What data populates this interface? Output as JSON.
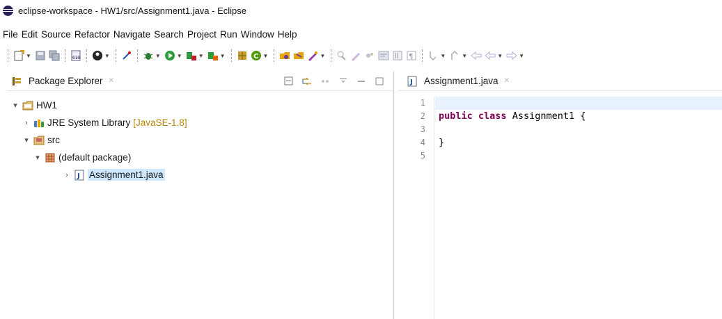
{
  "window": {
    "title": "eclipse-workspace - HW1/src/Assignment1.java - Eclipse"
  },
  "menu": [
    "File",
    "Edit",
    "Source",
    "Refactor",
    "Navigate",
    "Search",
    "Project",
    "Run",
    "Window",
    "Help"
  ],
  "package_explorer": {
    "title": "Package Explorer",
    "close": "✕",
    "tree": {
      "project": "HW1",
      "jre": {
        "label": "JRE System Library",
        "decoration": "[JavaSE-1.8]"
      },
      "src": "src",
      "package": "(default package)",
      "file": "Assignment1.java"
    }
  },
  "editor": {
    "tab_title": "Assignment1.java",
    "close": "✕",
    "line_numbers": [
      "1",
      "2",
      "3",
      "4",
      "5"
    ],
    "code": {
      "kw_public": "public",
      "kw_class": "class",
      "class_rest": " Assignment1 {",
      "closing": "}"
    }
  },
  "icons": {
    "toolbar": [
      "new-icon",
      "save-icon",
      "save-all-icon",
      "binary-icon",
      "target-icon",
      "pin-icon",
      "debug-icon",
      "run-icon",
      "run-external-icon",
      "coverage-icon",
      "new-java-package-icon",
      "new-class-icon",
      "open-type-icon",
      "open-task-icon",
      "annotation-icon",
      "pencil-icon",
      "toggle-mark-icon",
      "block-selection-icon",
      "show-whitespace-icon",
      "next-annotation-icon",
      "prev-annotation-icon",
      "back-icon",
      "forward-icon"
    ]
  },
  "colors": {
    "keyword": "#7f0055",
    "selection": "#cde8ff",
    "current_line": "#e8f2fe",
    "decoration": "#b8860b"
  }
}
